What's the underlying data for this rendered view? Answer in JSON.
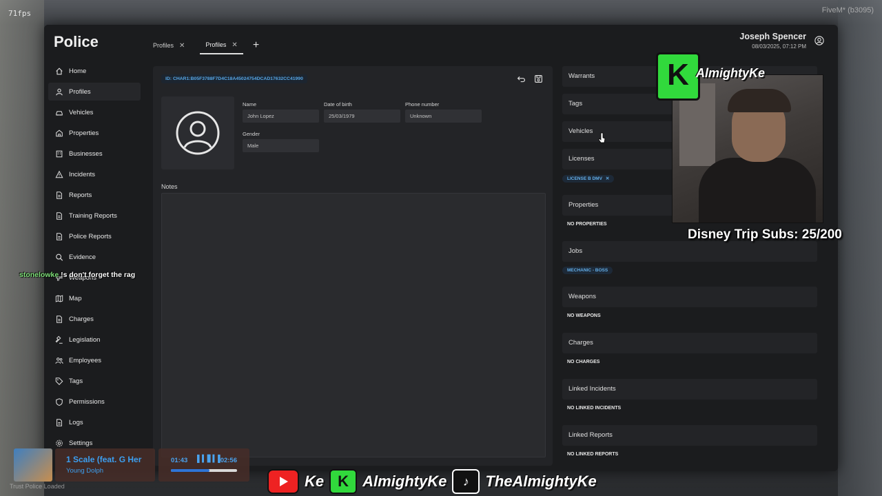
{
  "hud": {
    "fps": "71fps",
    "client": "FiveM* (b3095)"
  },
  "app": {
    "title": "Police"
  },
  "user": {
    "name": "Joseph Spencer",
    "datetime": "08/03/2025, 07:12 PM"
  },
  "tabs": [
    {
      "label": "Profiles",
      "active": false
    },
    {
      "label": "Profiles",
      "active": true
    }
  ],
  "sidebar": {
    "items": [
      {
        "label": "Home",
        "icon": "home-icon"
      },
      {
        "label": "Profiles",
        "icon": "user-icon",
        "active": true
      },
      {
        "label": "Vehicles",
        "icon": "car-icon"
      },
      {
        "label": "Properties",
        "icon": "building-icon"
      },
      {
        "label": "Businesses",
        "icon": "business-icon"
      },
      {
        "label": "Incidents",
        "icon": "warning-icon"
      },
      {
        "label": "Reports",
        "icon": "document-icon"
      },
      {
        "label": "Training Reports",
        "icon": "document-icon"
      },
      {
        "label": "Police Reports",
        "icon": "document-icon"
      },
      {
        "label": "Evidence",
        "icon": "search-icon"
      },
      {
        "label": "Weapons",
        "icon": "weapon-icon"
      },
      {
        "label": "Map",
        "icon": "map-icon"
      },
      {
        "label": "Charges",
        "icon": "document-icon"
      },
      {
        "label": "Legislation",
        "icon": "gavel-icon"
      },
      {
        "label": "Employees",
        "icon": "users-icon"
      },
      {
        "label": "Tags",
        "icon": "tag-icon"
      },
      {
        "label": "Permissions",
        "icon": "shield-icon"
      },
      {
        "label": "Logs",
        "icon": "document-icon"
      },
      {
        "label": "Settings",
        "icon": "gear-icon"
      }
    ]
  },
  "profile": {
    "id": "ID: CHAR1:B05F3788F7D4C18A45024754DCAD17632CC41990",
    "name_label": "Name",
    "name_value": "John Lopez",
    "dob_label": "Date of birth",
    "dob_value": "25/03/1979",
    "phone_label": "Phone number",
    "phone_value": "Unknown",
    "gender_label": "Gender",
    "gender_value": "Male",
    "notes_label": "Notes"
  },
  "sections": {
    "warrants": "Warrants",
    "tags": "Tags",
    "vehicles": "Vehicles",
    "licenses": "Licenses",
    "license_chip": "LICENSE B DMV",
    "properties": "Properties",
    "properties_none": "NO PROPERTIES",
    "jobs": "Jobs",
    "job_chip": "MECHANIC - BOSS",
    "weapons": "Weapons",
    "weapons_none": "NO WEAPONS",
    "charges": "Charges",
    "charges_none": "NO CHARGES",
    "linked_incidents": "Linked Incidents",
    "linked_incidents_none": "NO LINKED INCIDENTS",
    "linked_reports": "Linked Reports",
    "linked_reports_none": "NO LINKED REPORTS"
  },
  "overlay": {
    "channel_name": "AlmightyKe",
    "subs_goal": "Disney Trip Subs: 25/200",
    "chat_user": "stonelowke",
    "chat_message": "!s don't forget the rag",
    "song_title": "1 Scale (feat. G Her",
    "song_artist": "Young Dolph",
    "time_elapsed": "01:43",
    "time_total": "02:56",
    "progress": 0.58,
    "ticker": "Trust Police Loaded",
    "social_youtube": "Ke",
    "social_kick": "AlmightyKe",
    "social_tiktok": "TheAlmightyKe"
  },
  "colors": {
    "accent": "#57a7e6",
    "panel": "#232427",
    "background": "#1b1c1e",
    "kick_green": "#31d93c"
  }
}
